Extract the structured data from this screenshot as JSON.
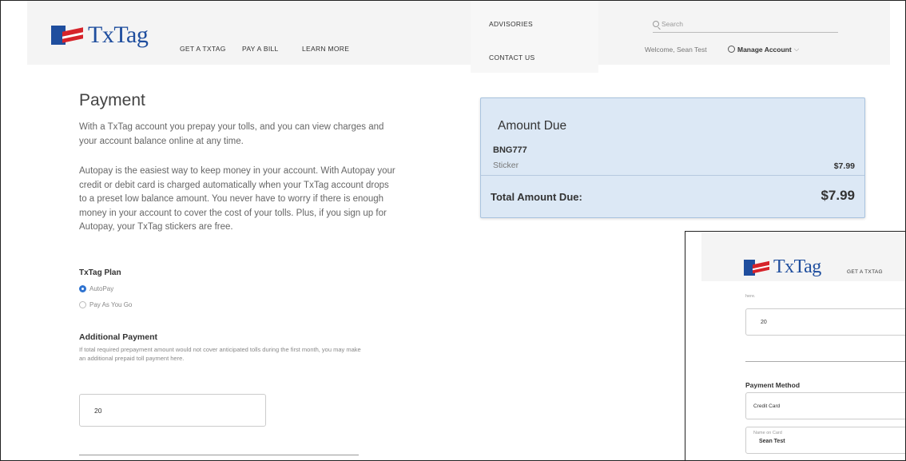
{
  "header": {
    "logo_text": "TxTag",
    "nav": [
      "GET A TXTAG",
      "PAY A BILL",
      "LEARN MORE"
    ],
    "dropdown": [
      "ADVISORIES",
      "CONTACT US"
    ],
    "search_placeholder": "Search",
    "welcome": "Welcome, Sean Test",
    "manage_account": "Manage Account"
  },
  "main": {
    "title": "Payment",
    "para1": "With a TxTag account you prepay your tolls, and you can view charges and your account balance online at any time.",
    "para2": "Autopay is the easiest way to keep money in your account. With Autopay your credit or debit card is charged automatically when your TxTag account drops to a preset low balance amount. You never have to worry if there is enough money in your account to cover the cost of your tolls. Plus, if you sign up for Autopay, your TxTag stickers are free.",
    "plan_label": "TxTag Plan",
    "plan_options": [
      "AutoPay",
      "Pay As You Go"
    ],
    "additional_label": "Additional Payment",
    "additional_desc": "If total required prepayment amount would not cover anticipated tolls during the first month, you may make an additional prepaid toll payment here.",
    "additional_value": "20"
  },
  "summary": {
    "title": "Amount Due",
    "plate": "BNG777",
    "item": "Sticker",
    "item_amount": "$7.99",
    "total_label": "Total Amount Due:",
    "total_amount": "$7.99"
  },
  "inset": {
    "logo_text": "TxTag",
    "nav_item": "GET A TXTAG",
    "here_text": "here.",
    "additional_value": "20",
    "payment_method_label": "Payment Method",
    "payment_method_value": "Credit Card",
    "name_label": "Name on Card",
    "name_value": "Sean Test"
  }
}
